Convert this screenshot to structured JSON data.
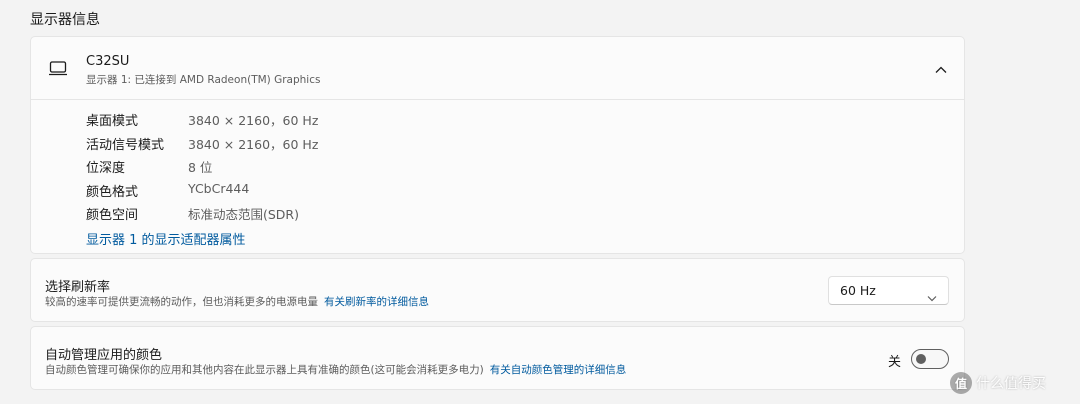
{
  "section_title": "显示器信息",
  "display": {
    "name": "C32SU",
    "subtitle": "显示器 1: 已连接到 AMD Radeon(TM) Graphics",
    "icon": "monitor-icon",
    "collapse_icon": "chevron-up-icon",
    "info": [
      {
        "label": "桌面模式",
        "value": "3840 × 2160，60 Hz"
      },
      {
        "label": "活动信号模式",
        "value": "3840 × 2160，60 Hz"
      },
      {
        "label": "位深度",
        "value": "8 位"
      },
      {
        "label": "颜色格式",
        "value": "YCbCr444"
      },
      {
        "label": "颜色空间",
        "value": "标准动态范围(SDR)"
      }
    ],
    "adapter_link": "显示器 1 的显示适配器属性"
  },
  "refresh": {
    "title": "选择刷新率",
    "description": "较高的速率可提供更流畅的动作，但也消耗更多的电源电量",
    "link": "有关刷新率的详细信息",
    "selected": "60 Hz"
  },
  "color_management": {
    "title": "自动管理应用的颜色",
    "description": "自动颜色管理可确保你的应用和其他内容在此显示器上具有准确的颜色(这可能会消耗更多电力)",
    "link": "有关自动颜色管理的详细信息",
    "toggle_label": "关",
    "toggle_on": false
  },
  "watermark": {
    "logo": "值",
    "text": "什么值得买"
  },
  "colors": {
    "accent_link": "#005a9e",
    "background": "#f3f3f3",
    "card": "#fbfbfb"
  }
}
